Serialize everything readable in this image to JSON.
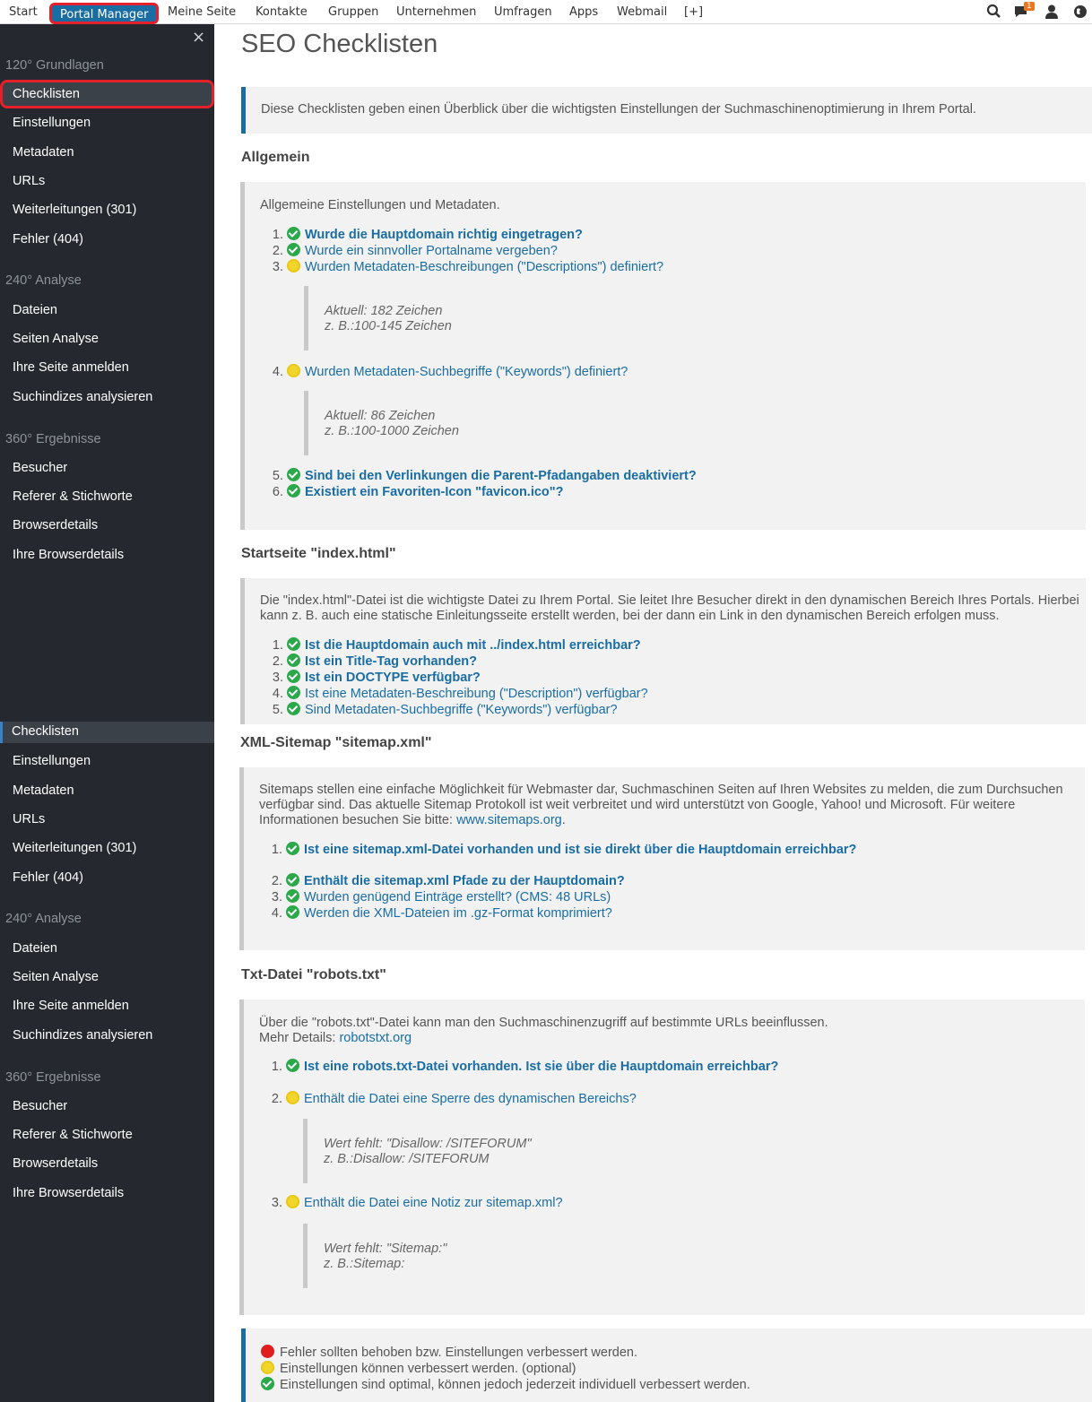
{
  "topnav": {
    "items": [
      "Start",
      "Portal Manager",
      "Meine Seite",
      "Kontakte",
      "Gruppen",
      "Unternehmen",
      "Umfragen",
      "Apps",
      "Webmail",
      "[+]"
    ],
    "active": "Portal Manager",
    "icons": [
      "search-icon",
      "messages-icon",
      "user-icon",
      "globe-icon"
    ],
    "message_count": "1"
  },
  "sidebar": {
    "close": "×",
    "groups": [
      "120° Grundlagen",
      "240° Analyse",
      "360° Ergebnisse"
    ],
    "items_grundlagen": [
      "Checklisten",
      "Einstellungen",
      "Metadaten",
      "URLs",
      "Weiterleitungen (301)",
      "Fehler (404)"
    ],
    "items_analyse": [
      "Dateien",
      "Seiten Analyse",
      "Ihre Seite anmelden",
      "Suchindizes analysieren"
    ],
    "items_ergebnisse": [
      "Besucher",
      "Referer & Stichworte",
      "Browserdetails",
      "Ihre Browserdetails"
    ],
    "active_item": "Checklisten"
  },
  "main": {
    "title": "SEO Checklisten",
    "intro": "Diese Checklisten geben einen Überblick über die wichtigsten Einstellungen der Suchmaschinenoptimierung in Ihrem Portal.",
    "sections": {
      "allgemein": {
        "heading": "Allgemein",
        "desc": "Allgemeine Einstellungen und Metadaten.",
        "items": [
          {
            "n": "1.",
            "status": "green",
            "text": "Wurde die Hauptdomain richtig eingetragen?",
            "bold": true
          },
          {
            "n": "2.",
            "status": "green",
            "text": "Wurde ein sinnvoller Portalname vergeben?",
            "bold": false
          },
          {
            "n": "3.",
            "status": "yellow",
            "text": "Wurden Metadaten-Beschreibungen (\"Descriptions\") definiert?",
            "bold": false
          },
          {
            "n": "4.",
            "status": "yellow",
            "text": "Wurden Metadaten-Suchbegriffe (\"Keywords\") definiert?",
            "bold": false
          },
          {
            "n": "5.",
            "status": "green",
            "text": "Sind bei den Verlinkungen die Parent-Pfadangaben deaktiviert?",
            "bold": true
          },
          {
            "n": "6.",
            "status": "green",
            "text": "Existiert ein Favoriten-Icon \"favicon.ico\"?",
            "bold": true
          }
        ],
        "note3": [
          "Aktuell: 182 Zeichen",
          "z. B.:100-145 Zeichen"
        ],
        "note4": [
          "Aktuell: 86 Zeichen",
          "z. B.:100-1000 Zeichen"
        ]
      },
      "startseite": {
        "heading": "Startseite \"index.html\"",
        "desc": "Die \"index.html\"-Datei ist die wichtigste Datei zu Ihrem Portal. Sie leitet Ihre Besucher direkt in den dynamischen Bereich Ihres Portals. Hierbei kann z. B. auch eine statische Einleitungsseite erstellt werden, bei der dann ein Link in den dynamischen Bereich erfolgen muss.",
        "items": [
          {
            "n": "1.",
            "status": "green",
            "text": "Ist die Hauptdomain auch mit ../index.html erreichbar?",
            "bold": true
          },
          {
            "n": "2.",
            "status": "green",
            "text": "Ist ein Title-Tag vorhanden?",
            "bold": true
          },
          {
            "n": "3.",
            "status": "green",
            "text": "Ist ein DOCTYPE verfügbar?",
            "bold": true
          },
          {
            "n": "4.",
            "status": "green",
            "text": "Ist eine Metadaten-Beschreibung (\"Description\") verfügbar?",
            "bold": false
          },
          {
            "n": "5.",
            "status": "green",
            "text": "Sind Metadaten-Suchbegriffe (\"Keywords\") verfügbar?",
            "bold": false
          }
        ]
      },
      "sitemap": {
        "heading": "XML-Sitemap \"sitemap.xml\"",
        "desc": "Sitemaps stellen eine einfache Möglichkeit für Webmaster dar, Suchmaschinen Seiten auf Ihren Websites zu melden, die zum Durchsuchen verfügbar sind. Das aktuelle Sitemap Protokoll ist weit verbreitet und wird unterstützt von Google, Yahoo! und Microsoft. Für weitere Informationen besuchen Sie bitte: ",
        "link": "www.sitemaps.org",
        "items": [
          {
            "n": "1.",
            "status": "green",
            "text": "Ist eine sitemap.xml-Datei vorhanden und ist sie direkt über die Hauptdomain erreichbar?",
            "bold": true
          },
          {
            "n": "2.",
            "status": "green",
            "text": "Enthält die sitemap.xml Pfade zu der Hauptdomain?",
            "bold": true
          },
          {
            "n": "3.",
            "status": "green",
            "text": "Wurden genügend Einträge erstellt? (CMS: 48 URLs)",
            "bold": false
          },
          {
            "n": "4.",
            "status": "green",
            "text": "Werden die XML-Dateien im .gz-Format komprimiert?",
            "bold": false
          }
        ]
      },
      "robots": {
        "heading": "Txt-Datei \"robots.txt\"",
        "desc": "Über die \"robots.txt\"-Datei kann man den Suchmaschinenzugriff auf bestimmte URLs beeinflussen.",
        "desc2": "Mehr Details: ",
        "link": "robotstxt.org",
        "items": [
          {
            "n": "1.",
            "status": "green",
            "text": "Ist eine robots.txt-Datei vorhanden. Ist sie über die Hauptdomain erreichbar?",
            "bold": true
          },
          {
            "n": "2.",
            "status": "yellow",
            "text": "Enthält die Datei eine Sperre des dynamischen Bereichs?",
            "bold": false
          },
          {
            "n": "3.",
            "status": "yellow",
            "text": "Enthält die Datei eine Notiz zur sitemap.xml?",
            "bold": false
          }
        ],
        "note2": [
          "Wert fehlt: \"Disallow: /SITEFORUM\"",
          "z. B.:Disallow: /SITEFORUM"
        ],
        "note3": [
          "Wert fehlt: \"Sitemap:\"",
          "z. B.:Sitemap:"
        ]
      }
    },
    "legend": [
      {
        "status": "red",
        "text": "Fehler sollten behoben bzw. Einstellungen verbessert werden."
      },
      {
        "status": "yellow",
        "text": "Einstellungen können verbessert werden. (optional)"
      },
      {
        "status": "green",
        "text": "Einstellungen sind optimal, können jedoch jederzeit individuell verbessert werden."
      }
    ]
  }
}
